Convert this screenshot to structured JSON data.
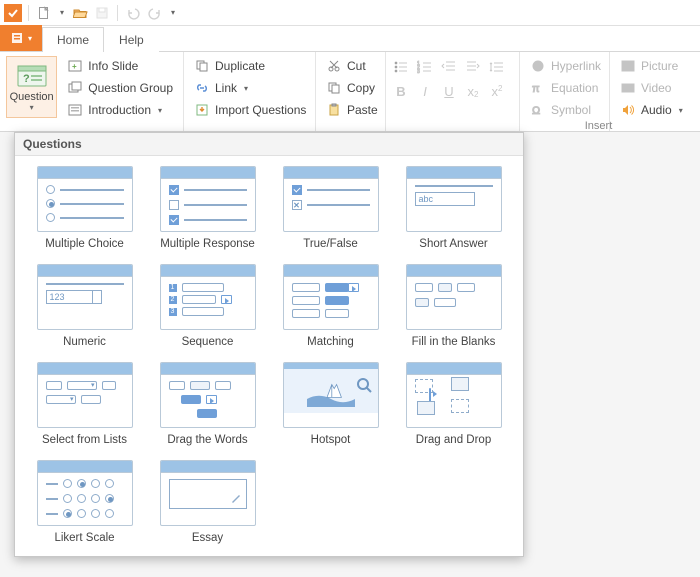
{
  "tabs": {
    "home": "Home",
    "help": "Help"
  },
  "ribbon": {
    "question": "Question",
    "info_slide": "Info Slide",
    "question_group": "Question Group",
    "introduction": "Introduction",
    "duplicate": "Duplicate",
    "link": "Link",
    "import_questions": "Import Questions",
    "cut": "Cut",
    "copy": "Copy",
    "paste": "Paste",
    "hyperlink": "Hyperlink",
    "equation": "Equation",
    "symbol": "Symbol",
    "picture": "Picture",
    "video": "Video",
    "audio": "Audio",
    "insert_group": "Insert"
  },
  "format": {
    "bold": "B",
    "italic": "I",
    "underline": "U",
    "x": "x",
    "sub2": "2",
    "sup2": "2"
  },
  "panel": {
    "title": "Questions",
    "items": [
      "Multiple Choice",
      "Multiple Response",
      "True/False",
      "Short Answer",
      "Numeric",
      "Sequence",
      "Matching",
      "Fill in the Blanks",
      "Select from Lists",
      "Drag the Words",
      "Hotspot",
      "Drag and Drop",
      "Likert Scale",
      "Essay"
    ],
    "short_answer_sample": "abc",
    "numeric_sample": "123"
  }
}
